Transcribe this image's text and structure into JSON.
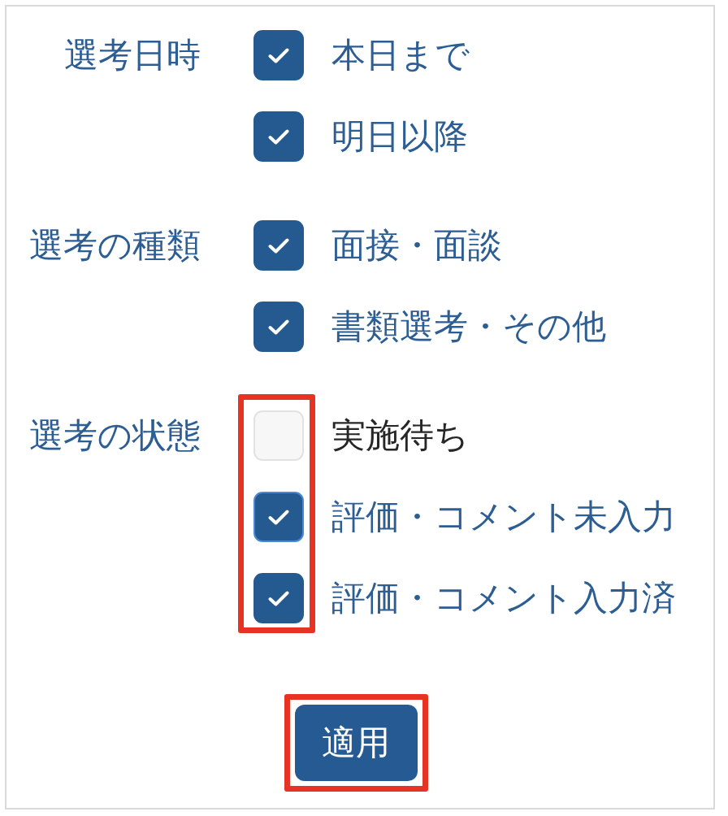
{
  "groups": [
    {
      "label": "選考日時",
      "highlighted": false,
      "options": [
        {
          "label": "本日まで",
          "checked": true,
          "focused": false
        },
        {
          "label": "明日以降",
          "checked": true,
          "focused": false
        }
      ]
    },
    {
      "label": "選考の種類",
      "highlighted": false,
      "options": [
        {
          "label": "面接・面談",
          "checked": true,
          "focused": false
        },
        {
          "label": "書類選考・その他",
          "checked": true,
          "focused": false
        }
      ]
    },
    {
      "label": "選考の状態",
      "highlighted": true,
      "options": [
        {
          "label": "実施待ち",
          "checked": false,
          "focused": false
        },
        {
          "label": "評価・コメント未入力",
          "checked": true,
          "focused": true
        },
        {
          "label": "評価・コメント入力済",
          "checked": true,
          "focused": false
        }
      ]
    }
  ],
  "apply_button": {
    "label": "適用",
    "highlighted": true
  }
}
